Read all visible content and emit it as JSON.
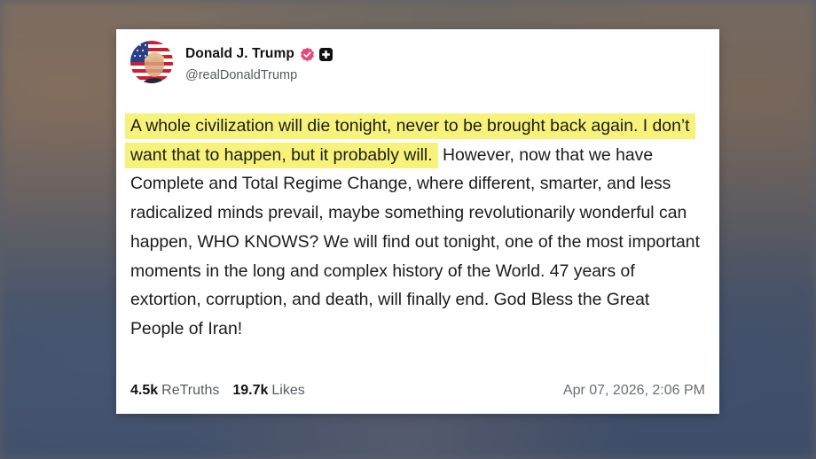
{
  "post": {
    "display_name": "Donald J. Trump",
    "handle": "@realDonaldTrump",
    "verified_icon": "verified-badge-icon",
    "plus_icon": "plus-badge-icon",
    "avatar_icon": "avatar-flag-portrait",
    "highlighted_text": "A whole civilization will die tonight, never to be brought back again. I don’t want that to happen, but it probably will.",
    "body_text": " However, now that we have Complete and Total Regime Change, where different, smarter, and less radicalized minds prevail, maybe something revolutionarily wonderful can happen, WHO KNOWS? We will find out tonight, one of the most important moments in the long and complex history of the World. 47 years of extortion, corruption, and death, will finally end. God Bless the Great People of Iran!",
    "retruths_count": "4.5k",
    "retruths_label": "ReTruths",
    "likes_count": "19.7k",
    "likes_label": "Likes",
    "timestamp": "Apr 07, 2026, 2:06 PM"
  },
  "colors": {
    "highlight": "#f7f27a",
    "verified": "#e8467c",
    "text": "#1c1c1c",
    "muted": "#555b63"
  }
}
